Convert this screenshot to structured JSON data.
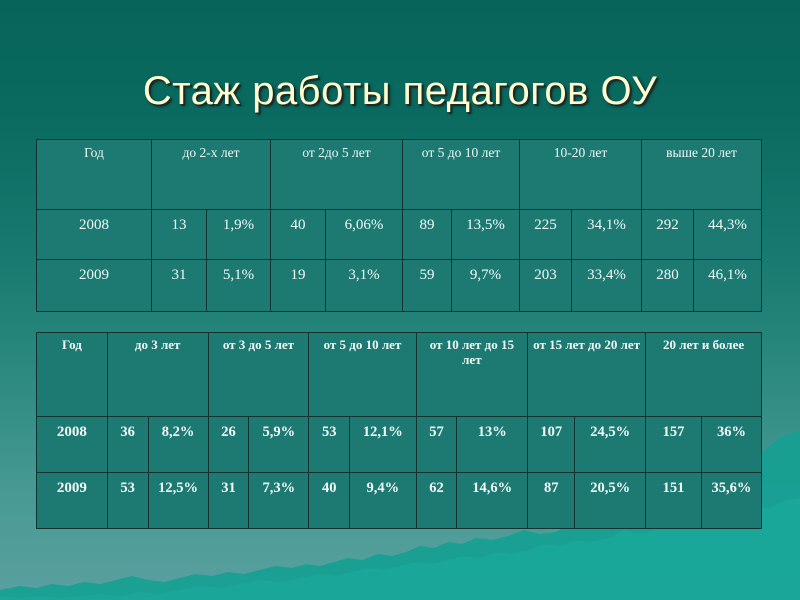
{
  "slide": {
    "title": "Стаж работы педагогов ОУ",
    "colors": {
      "background_top": "#07645a",
      "background_bottom": "#5aa0a0",
      "title_text": "#ffffcf",
      "table_fill": "#1d7a72",
      "table_border": "#14332f",
      "mountain": "#16a093"
    }
  },
  "table1": {
    "headers": [
      "Год",
      "до 2-х лет",
      "от 2до 5 лет",
      "от 5 до 10 лет",
      "10-20 лет",
      "выше 20 лет"
    ],
    "rows": [
      {
        "year": "2008",
        "cells": [
          "13",
          "1,9%",
          "40",
          "6,06%",
          "89",
          "13,5%",
          "225",
          "34,1%",
          "292",
          "44,3%"
        ]
      },
      {
        "year": "2009",
        "cells": [
          "31",
          "5,1%",
          "19",
          "3,1%",
          "59",
          "9,7%",
          "203",
          "33,4%",
          "280",
          "46,1%"
        ]
      }
    ]
  },
  "table2": {
    "headers": [
      "Год",
      "до 3 лет",
      "от 3 до 5 лет",
      "от 5 до 10 лет",
      "от 10 лет до 15 лет",
      "от 15 лет до 20 лет",
      "20 лет и более"
    ],
    "rows": [
      {
        "year": "2008",
        "cells": [
          "36",
          "8,2%",
          "26",
          "5,9%",
          "53",
          "12,1%",
          "57",
          "13%",
          "107",
          "24,5%",
          "157",
          "36%"
        ]
      },
      {
        "year": "2009",
        "cells": [
          "53",
          "12,5%",
          "31",
          "7,3%",
          "40",
          "9,4%",
          "62",
          "14,6%",
          "87",
          "20,5%",
          "151",
          "35,6%"
        ]
      }
    ]
  },
  "chart_data": {
    "type": "table",
    "title": "Стаж работы педагогов ОУ",
    "tables": [
      {
        "name": "Стаж работы (диапазоны 1)",
        "columns": [
          "Год",
          "до 2-х лет",
          "от 2до 5 лет",
          "от 5 до 10 лет",
          "10-20 лет",
          "выше 20 лет"
        ],
        "rows": [
          {
            "Год": "2008",
            "до 2-х лет": {
              "count": 13,
              "percent": "1,9%"
            },
            "от 2до 5 лет": {
              "count": 40,
              "percent": "6,06%"
            },
            "от 5 до 10 лет": {
              "count": 89,
              "percent": "13,5%"
            },
            "10-20 лет": {
              "count": 225,
              "percent": "34,1%"
            },
            "выше 20 лет": {
              "count": 292,
              "percent": "44,3%"
            }
          },
          {
            "Год": "2009",
            "до 2-х лет": {
              "count": 31,
              "percent": "5,1%"
            },
            "от 2до 5 лет": {
              "count": 19,
              "percent": "3,1%"
            },
            "от 5 до 10 лет": {
              "count": 59,
              "percent": "9,7%"
            },
            "10-20 лет": {
              "count": 203,
              "percent": "33,4%"
            },
            "выше 20 лет": {
              "count": 280,
              "percent": "46,1%"
            }
          }
        ]
      },
      {
        "name": "Стаж работы (диапазоны 2)",
        "columns": [
          "Год",
          "до 3 лет",
          "от 3 до 5 лет",
          "от 5 до 10 лет",
          "от 10 лет до 15 лет",
          "от 15 лет до 20 лет",
          "20 лет и более"
        ],
        "rows": [
          {
            "Год": "2008",
            "до 3 лет": {
              "count": 36,
              "percent": "8,2%"
            },
            "от 3 до 5 лет": {
              "count": 26,
              "percent": "5,9%"
            },
            "от 5 до 10 лет": {
              "count": 53,
              "percent": "12,1%"
            },
            "от 10 лет до 15 лет": {
              "count": 57,
              "percent": "13%"
            },
            "от 15 лет до 20 лет": {
              "count": 107,
              "percent": "24,5%"
            },
            "20 лет и более": {
              "count": 157,
              "percent": "36%"
            }
          },
          {
            "Год": "2009",
            "до 3 лет": {
              "count": 53,
              "percent": "12,5%"
            },
            "от 3 до 5 лет": {
              "count": 31,
              "percent": "7,3%"
            },
            "от 5 до 10 лет": {
              "count": 40,
              "percent": "9,4%"
            },
            "от 10 лет до 15 лет": {
              "count": 62,
              "percent": "14,6%"
            },
            "от 15 лет до 20 лет": {
              "count": 87,
              "percent": "20,5%"
            },
            "20 лет и более": {
              "count": 151,
              "percent": "35,6%"
            }
          }
        ]
      }
    ]
  }
}
